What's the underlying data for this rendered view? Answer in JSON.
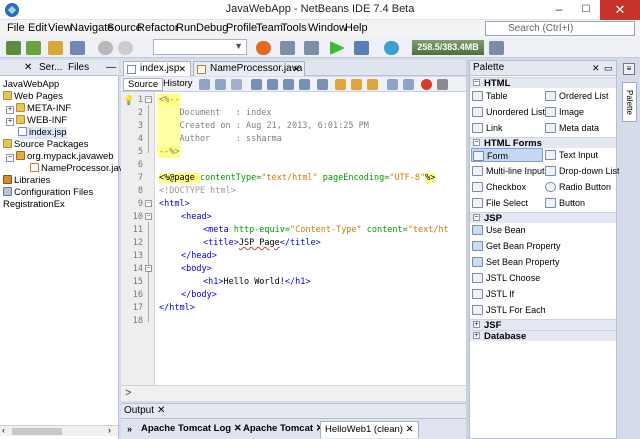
{
  "window": {
    "title": "JavaWebApp - NetBeans IDE 7.4 Beta",
    "minimize": "–",
    "maximize": "☐",
    "close": "✕"
  },
  "menu": [
    "File",
    "Edit",
    "View",
    "Navigate",
    "Source",
    "Refactor",
    "Run",
    "Debug",
    "Profile",
    "Team",
    "Tools",
    "Window",
    "Help"
  ],
  "search": {
    "placeholder": "Search (Ctrl+I)"
  },
  "toolbar": {
    "memory": "258.5/383.4MB"
  },
  "left_panel": {
    "tabs": [
      "Ser...",
      "Files"
    ],
    "close": "✕",
    "minimize": "—",
    "tree": [
      {
        "label": "JavaWebApp",
        "icon": "project-icon"
      },
      {
        "label": "Web Pages",
        "icon": "folder-icon"
      },
      {
        "label": "META-INF",
        "icon": "folder-icon"
      },
      {
        "label": "WEB-INF",
        "icon": "folder-icon"
      },
      {
        "label": "index.jsp",
        "icon": "jsp-file-icon"
      },
      {
        "label": "Source Packages",
        "icon": "folder-icon"
      },
      {
        "label": "org.mypack.javaweb",
        "icon": "package-icon"
      },
      {
        "label": "NameProcessor.java",
        "icon": "java-file-icon"
      },
      {
        "label": "Libraries",
        "icon": "libraries-icon"
      },
      {
        "label": "Configuration Files",
        "icon": "config-icon"
      },
      {
        "label": "RegistrationEx",
        "icon": "project-icon"
      }
    ]
  },
  "editor_tabs": [
    {
      "label": "index.jsp",
      "close": "✕"
    },
    {
      "label": "NameProcessor.java",
      "close": "✕"
    }
  ],
  "source_bar": {
    "source": "Source",
    "history": "History"
  },
  "code": {
    "line_numbers": [
      "1",
      "2",
      "3",
      "4",
      "5",
      "6",
      "7",
      "8",
      "9",
      "10",
      "11",
      "12",
      "13",
      "14",
      "15",
      "16",
      "17",
      "18"
    ],
    "lines": {
      "l1": "<%--",
      "l2": "    Document   : index",
      "l3": "    Created on : Aug 21, 2013, 6:01:25 PM",
      "l4": "    Author     : ssharma",
      "l5": "--%>",
      "l7a": "<%@page ",
      "l7b": "contentType=",
      "l7c": "\"text/html\"",
      "l7d": " pageEncoding=",
      "l7e": "\"UTF-8\"",
      "l7f": "%>",
      "l8": "<!DOCTYPE html>",
      "l9": "<html>",
      "l10": "<head>",
      "l11a": "<meta ",
      "l11b": "http-equiv=",
      "l11c": "\"Content-Type\"",
      "l11d": " content=",
      "l11e": "\"text/ht",
      "l12a": "<title>",
      "l12b": "JSP Page",
      "l12c": "</title>",
      "l13": "</head>",
      "l14": "<body>",
      "l15a": "<h1>",
      "l15b": "Hello World!",
      "l15c": "</h1>",
      "l16": "</body>",
      "l17": "</html>"
    }
  },
  "palette": {
    "title": "Palette",
    "close": "✕",
    "side_tab": "Palette",
    "categories": {
      "html": "HTML",
      "html_forms": "HTML Forms",
      "jsp": "JSP",
      "jsf": "JSF",
      "database": "Database"
    },
    "html_items": [
      "Table",
      "Ordered List",
      "Unordered List",
      "Image",
      "Link",
      "Meta data"
    ],
    "form_items": [
      "Form",
      "Text Input",
      "Multi-line Input",
      "Drop-down List",
      "Checkbox",
      "Radio Button",
      "File Select",
      "Button"
    ],
    "jsp_items": [
      "Use Bean",
      "Get Bean Property",
      "Set Bean Property",
      "JSTL Choose",
      "JSTL If",
      "JSTL For Each"
    ]
  },
  "output": {
    "title": "Output",
    "close": "✕",
    "tabs": [
      {
        "label": "Apache Tomcat Log",
        "close": "✕"
      },
      {
        "label": "Apache Tomcat",
        "close": "✕"
      },
      {
        "label": "HelloWeb1 (clean)",
        "close": "✕"
      }
    ],
    "overflow": "»"
  }
}
